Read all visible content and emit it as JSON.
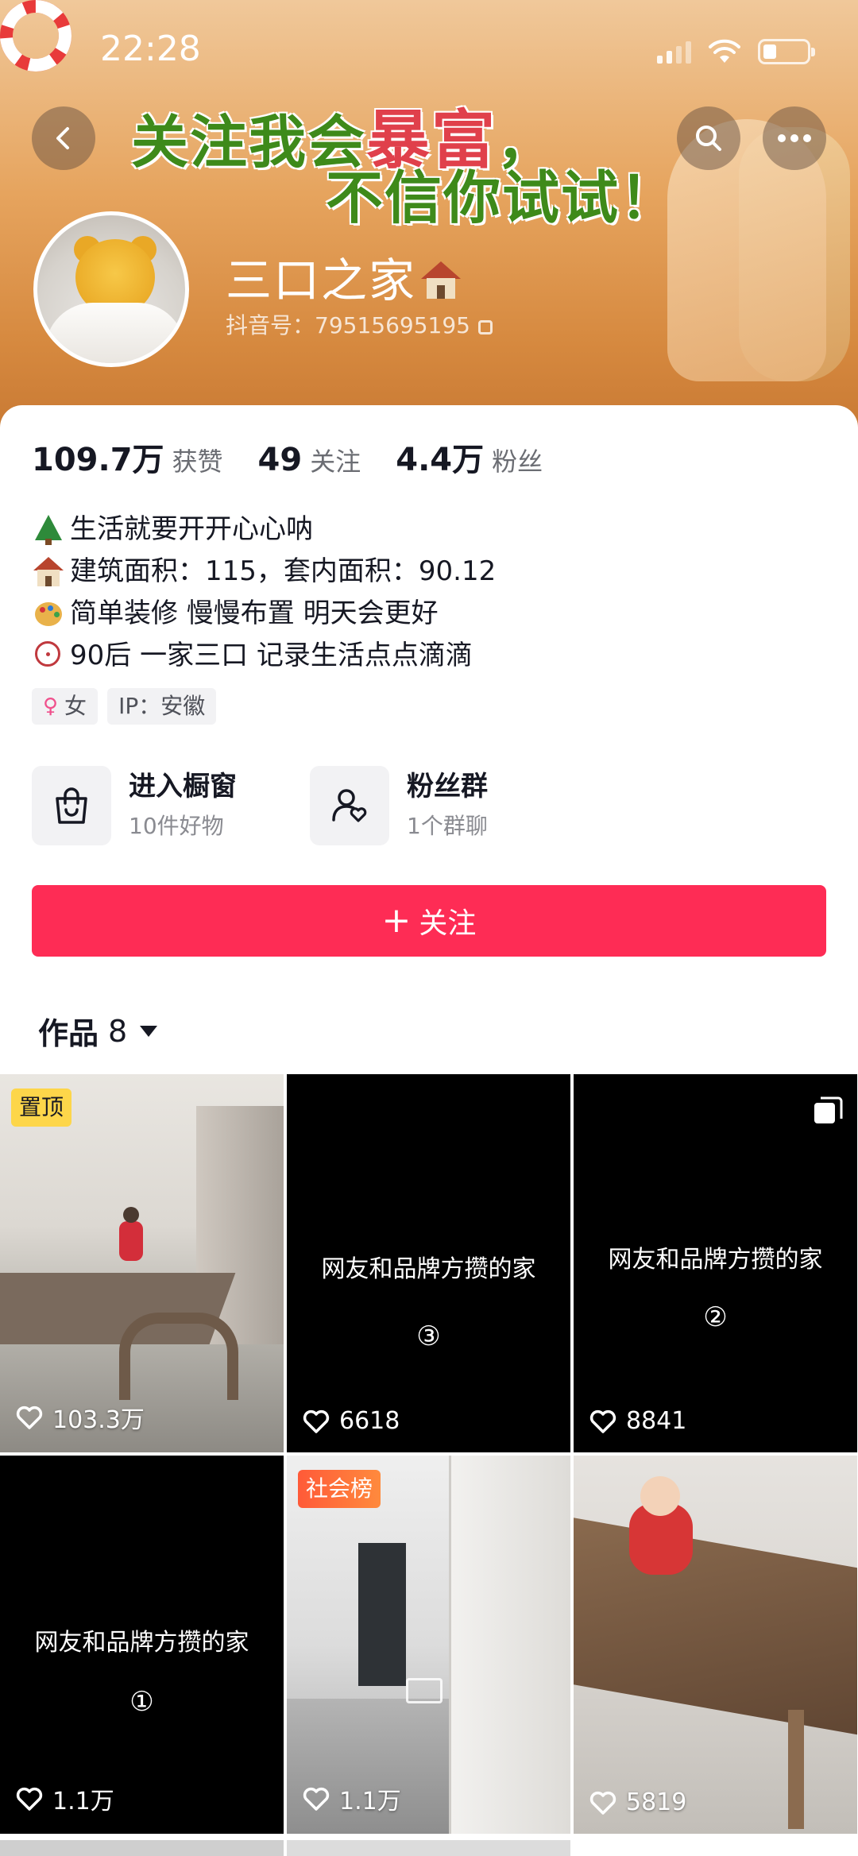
{
  "status_bar": {
    "time": "22:28"
  },
  "banner": {
    "slogan_line1_a": "关注我会",
    "slogan_line1_b": "暴富",
    "slogan_line1_c": "，",
    "slogan_line2": "不信你试试！"
  },
  "profile": {
    "name": "三口之家",
    "douyin_id": "抖音号：79515695195"
  },
  "stats": [
    {
      "value": "109.7万",
      "label": "获赞"
    },
    {
      "value": "49",
      "label": "关注"
    },
    {
      "value": "4.4万",
      "label": "粉丝"
    }
  ],
  "bio": [
    {
      "icon": "tree-icon",
      "text": "生活就要开开心心呐"
    },
    {
      "icon": "house-icon",
      "text": "建筑面积：115，套内面积：90.12"
    },
    {
      "icon": "palette-icon",
      "text": "简单装修 慢慢布置 明天会更好"
    },
    {
      "icon": "ferris-wheel-icon",
      "text": "90后 一家三口 记录生活点点滴滴"
    }
  ],
  "tags": {
    "gender": "女",
    "ip": "IP：安徽"
  },
  "shortcuts": {
    "shop_title": "进入橱窗",
    "shop_sub": "10件好物",
    "fans_title": "粉丝群",
    "fans_sub": "1个群聊"
  },
  "follow_button": "关注",
  "works": {
    "label": "作品",
    "count": "8"
  },
  "videos": [
    {
      "badge": "置顶",
      "likes": "103.3万"
    },
    {
      "caption": "网友和品牌方攒的家",
      "number": "③",
      "likes": "6618"
    },
    {
      "caption": "网友和品牌方攒的家",
      "number": "②",
      "likes": "8841"
    },
    {
      "caption": "网友和品牌方攒的家",
      "number": "①",
      "likes": "1.1万"
    },
    {
      "badge": "社会榜",
      "likes": "1.1万"
    },
    {
      "likes": "5819"
    }
  ],
  "colors": {
    "follow": "#fe2c55",
    "badge_pin": "#fdd64a",
    "badge_hot": "#ff5a38"
  }
}
